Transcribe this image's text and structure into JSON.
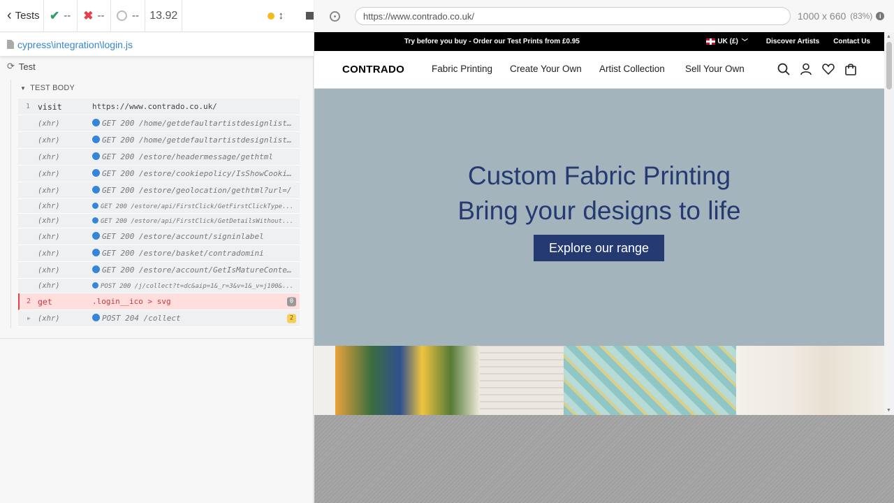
{
  "reporter": {
    "stats": {
      "back_label": "Tests",
      "passed": "--",
      "failed": "--",
      "pending": "--",
      "duration": "13.92"
    },
    "spec_path": "cypress\\integration\\login.js",
    "runnable_title": "Test",
    "hook_title": "TEST BODY",
    "commands": [
      {
        "num": "1",
        "name": "visit",
        "message": "https://www.contrado.co.uk/",
        "kind": "visit"
      },
      {
        "num": "",
        "name": "(xhr)",
        "message": "GET 200 /home/getdefaultartistdesignlist...",
        "kind": "xhr"
      },
      {
        "num": "",
        "name": "(xhr)",
        "message": "GET 200 /home/getdefaultartistdesignlist...",
        "kind": "xhr"
      },
      {
        "num": "",
        "name": "(xhr)",
        "message": "GET 200 /estore/headermessage/gethtml",
        "kind": "xhr"
      },
      {
        "num": "",
        "name": "(xhr)",
        "message": "GET 200 /estore/cookiepolicy/IsShowCooki...",
        "kind": "xhr"
      },
      {
        "num": "",
        "name": "(xhr)",
        "message": "GET 200 /estore/geolocation/gethtml?url=/",
        "kind": "xhr"
      },
      {
        "num": "",
        "name": "(xhr)",
        "message": "GET 200 /estore/api/FirstClick/GetFirstClickType...",
        "kind": "xhr-small"
      },
      {
        "num": "",
        "name": "(xhr)",
        "message": "GET 200 /estore/api/FirstClick/GetDetailsWithout...",
        "kind": "xhr-small"
      },
      {
        "num": "",
        "name": "(xhr)",
        "message": "GET 200 /estore/account/signinlabel",
        "kind": "xhr"
      },
      {
        "num": "",
        "name": "(xhr)",
        "message": "GET 200 /estore/basket/contradomini",
        "kind": "xhr"
      },
      {
        "num": "",
        "name": "(xhr)",
        "message": "GET 200 /estore/account/GetIsMatureConte...",
        "kind": "xhr"
      },
      {
        "num": "",
        "name": "(xhr)",
        "message": "POST 200 /j/collect?t=dc&aip=1&_r=3&v=1&_v=j100&...",
        "kind": "xhr-small"
      },
      {
        "num": "2",
        "name": "get",
        "message": ".login__ico > svg",
        "kind": "failed",
        "badge": "0"
      },
      {
        "num": "",
        "name": "(xhr)",
        "message": "POST 204 /collect",
        "kind": "xhr-expand",
        "badge": "2"
      }
    ]
  },
  "aut": {
    "url": "https://www.contrado.co.uk/",
    "viewport": "1000 x 660",
    "scale": "(83%)",
    "site": {
      "promo": "Try before you buy - Order our Test Prints from £0.95",
      "currency": "UK (£)",
      "discover": "Discover Artists",
      "contact": "Contact Us",
      "logo": "CONTRADO",
      "nav": [
        "Fabric Printing",
        "Create Your Own",
        "Artist Collection",
        "Sell Your Own"
      ],
      "hero_line1": "Custom Fabric Printing",
      "hero_line2": "Bring your designs to life",
      "hero_button": "Explore our range"
    }
  },
  "colors": {
    "hero_bg": "#a3b4bd",
    "brand_navy": "#263a72",
    "pass": "#2e9e6a",
    "fail": "#e2434b",
    "link_blue": "#3386d4"
  },
  "icons": [
    "chevron-left-icon",
    "check-icon",
    "x-icon",
    "pending-ring-icon",
    "running-dot-icon",
    "scroll-toggle-icon",
    "stop-icon",
    "file-icon",
    "refresh-icon",
    "selector-playground-icon",
    "info-icon",
    "search-icon",
    "user-icon",
    "heart-icon",
    "bag-icon"
  ]
}
